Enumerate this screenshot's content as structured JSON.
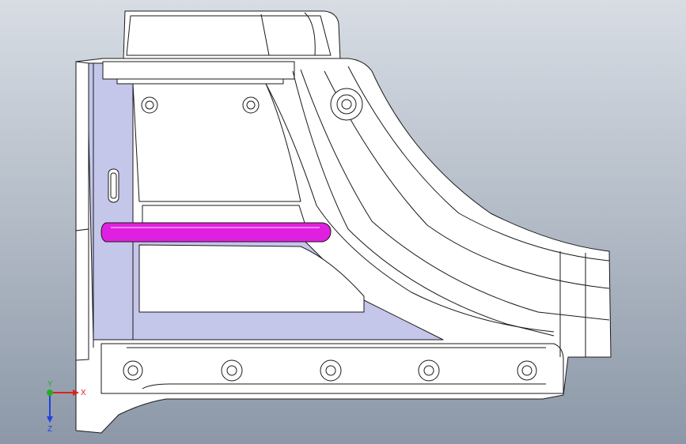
{
  "viewport": {
    "background_top": "#d8dde4",
    "background_bottom": "#8c98a8",
    "part_fill": "#ffffff",
    "part_shadow_fill": "#c4c6ea",
    "edge_color": "#1a1a1a",
    "highlight_color": "#e020e0"
  },
  "triad": {
    "x_label": "X",
    "y_label": "Y",
    "z_label": "Z",
    "x_color": "#e02020",
    "y_color": "#20b020",
    "z_color": "#2040e0"
  }
}
